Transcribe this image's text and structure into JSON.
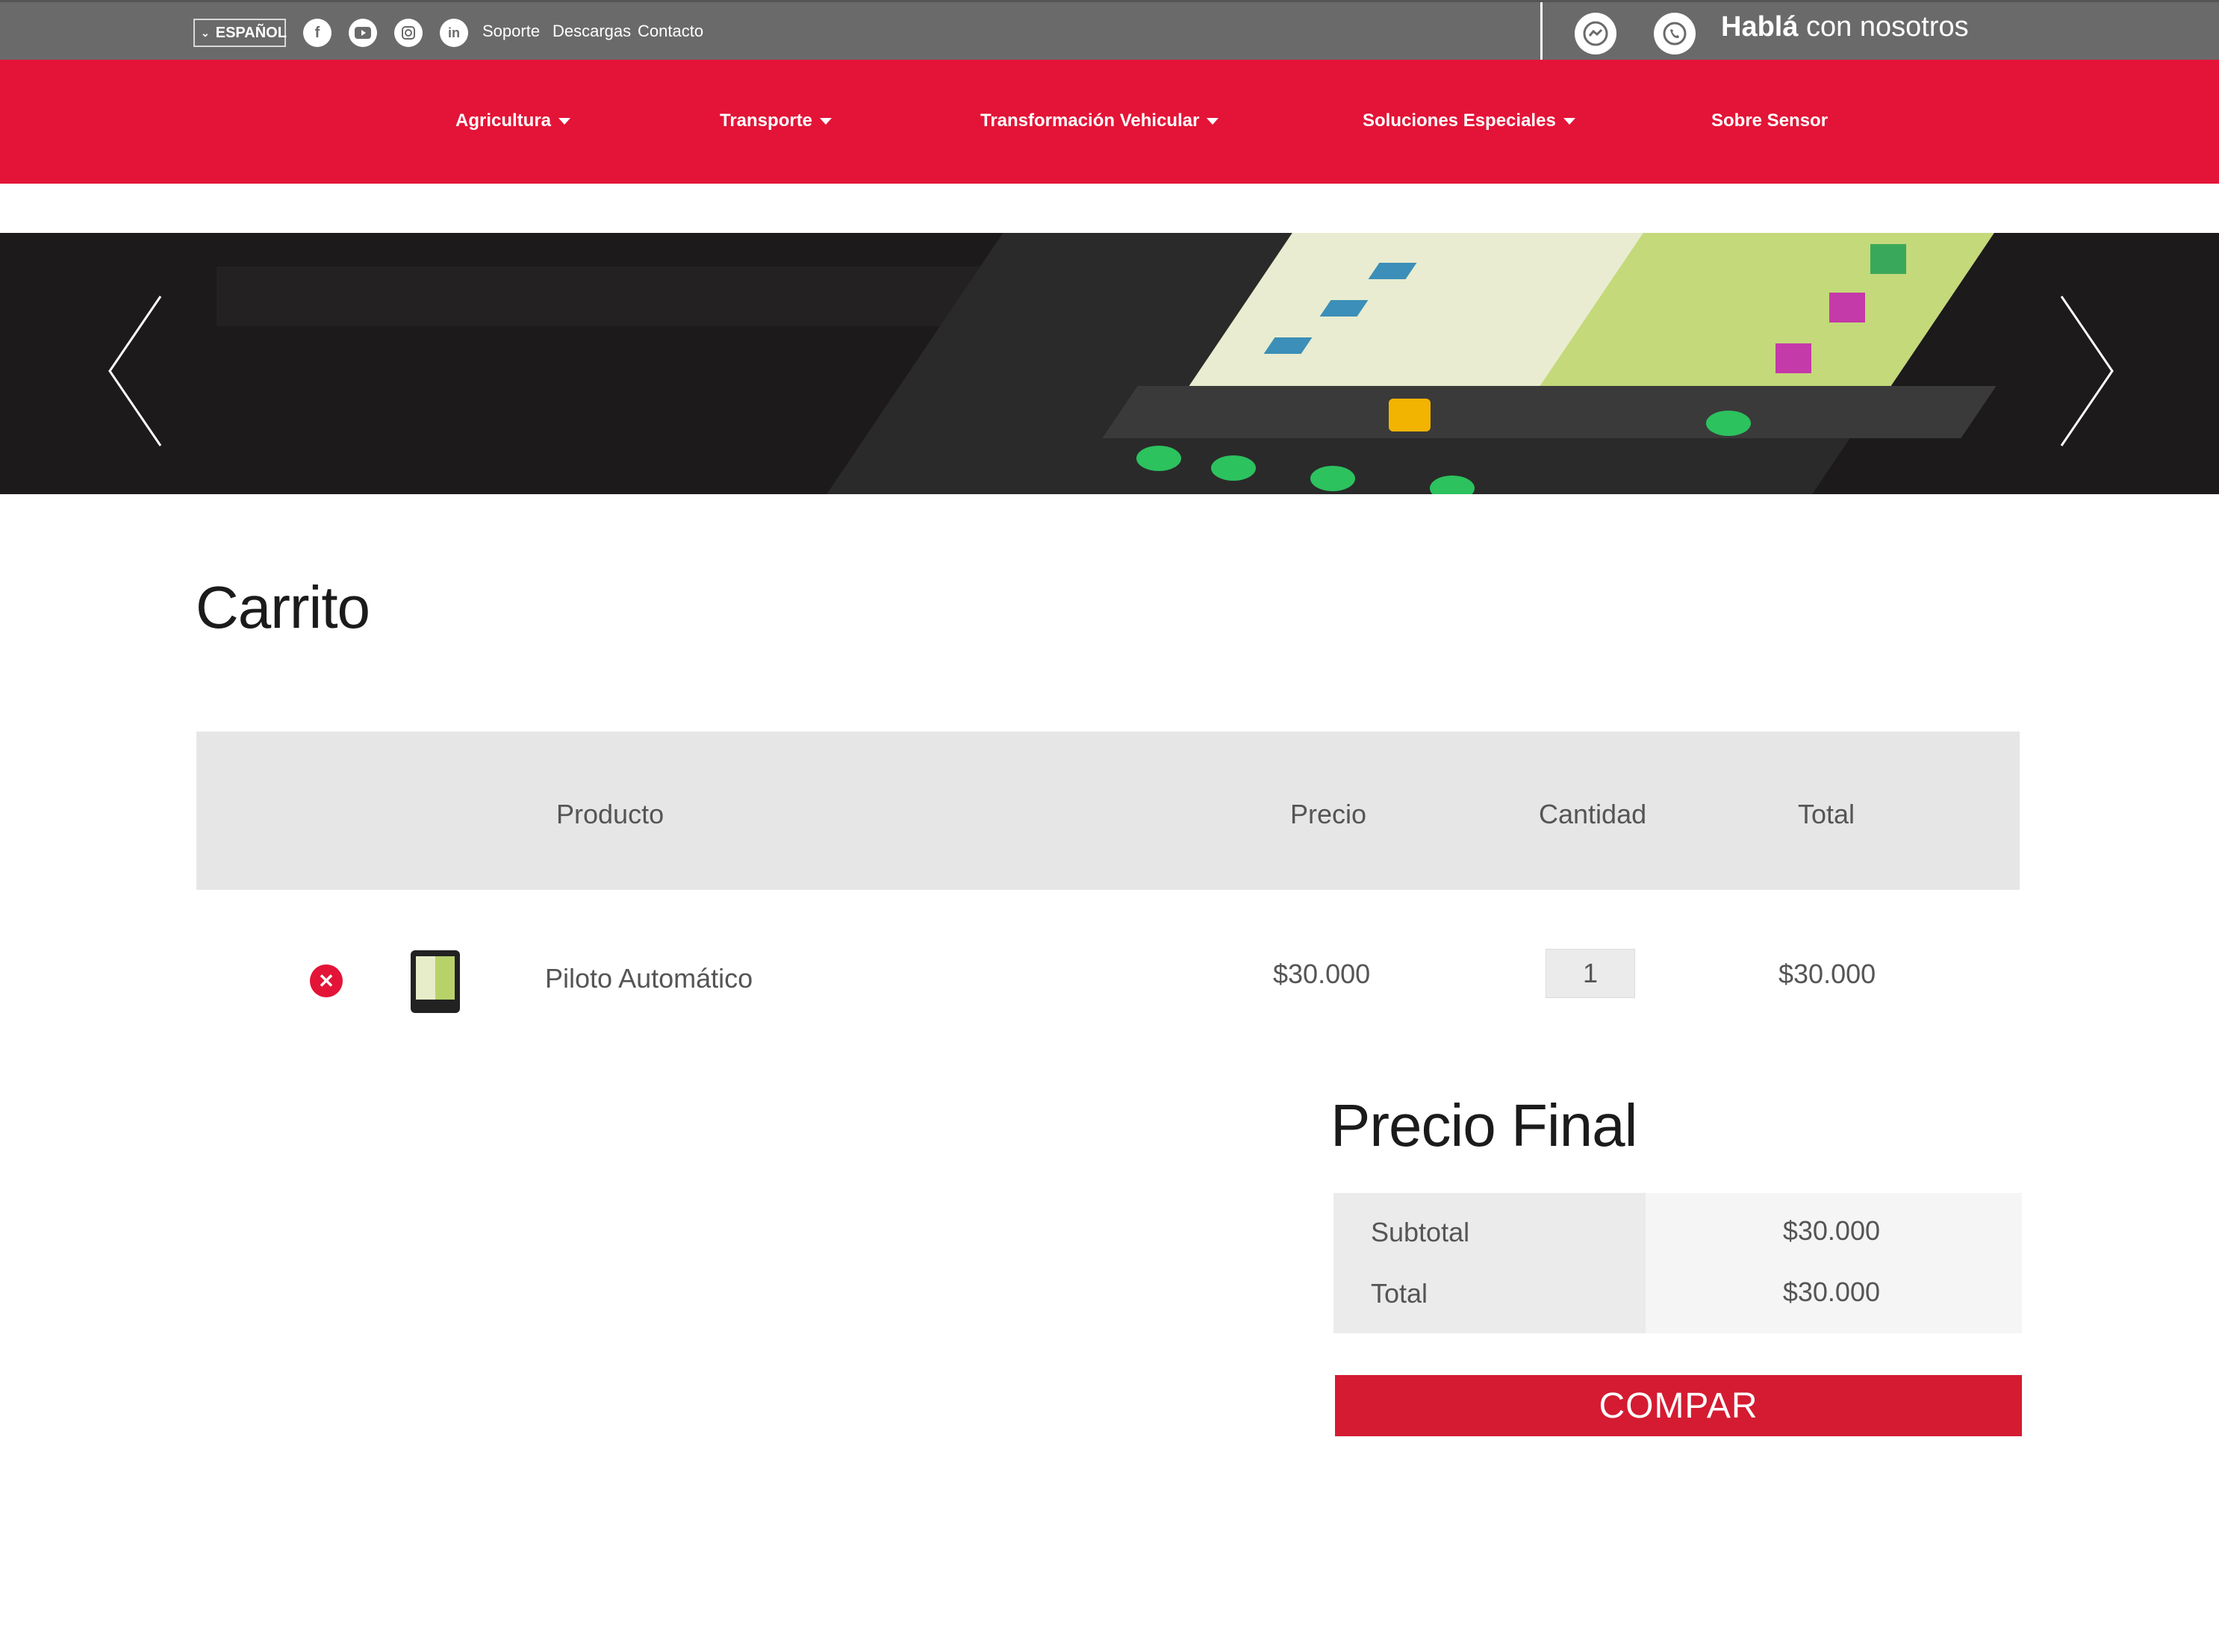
{
  "topbar": {
    "language": "ESPAÑOL",
    "social_icons": [
      "facebook-icon",
      "youtube-icon",
      "instagram-icon",
      "linkedin-icon"
    ],
    "links": [
      "Soporte",
      "Descargas",
      "Contacto"
    ],
    "chat_prefix": "Hablá",
    "chat_suffix": " con nosotros"
  },
  "nav": {
    "items": [
      {
        "label": "Agricultura",
        "dropdown": true
      },
      {
        "label": "Transporte",
        "dropdown": true
      },
      {
        "label": "Transformación Vehicular",
        "dropdown": true
      },
      {
        "label": "Soluciones Especiales",
        "dropdown": true
      },
      {
        "label": "Sobre Sensor",
        "dropdown": false
      }
    ]
  },
  "cart": {
    "title": "Carrito",
    "columns": {
      "product": "Producto",
      "price": "Precio",
      "quantity": "Cantidad",
      "total": "Total"
    },
    "items": [
      {
        "name": "Piloto Automático",
        "price": "$30.000",
        "quantity": "1",
        "total": "$30.000"
      }
    ]
  },
  "summary": {
    "title": "Precio Final",
    "subtotal_label": "Subtotal",
    "subtotal_value": "$30.000",
    "total_label": "Total",
    "total_value": "$30.000",
    "buy_label": "COMPAR"
  },
  "colors": {
    "brand_red": "#e31437",
    "topbar_gray": "#6b6a6b",
    "button_red": "#d41b31"
  }
}
